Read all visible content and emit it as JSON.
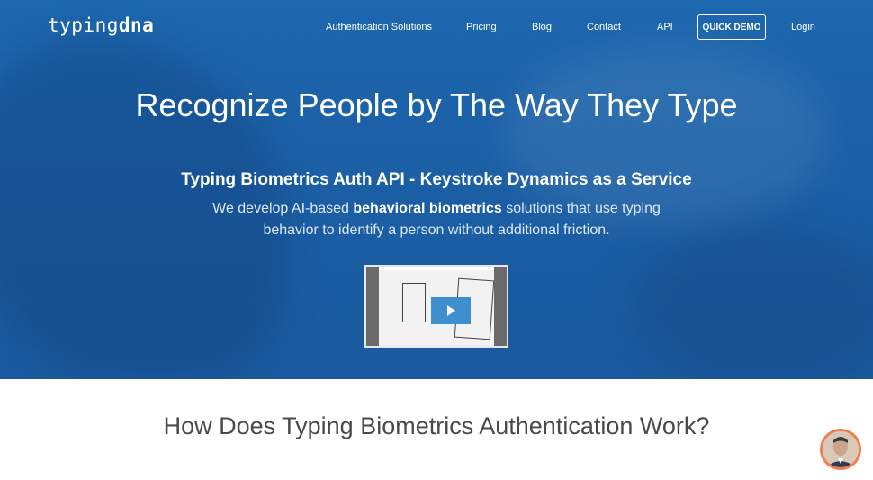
{
  "brand": {
    "logo_light": "typing",
    "logo_bold": "dna"
  },
  "nav": {
    "items": [
      "Authentication Solutions",
      "Pricing",
      "Blog",
      "Contact",
      "API"
    ],
    "demo_label": "QUICK DEMO",
    "login_label": "Login"
  },
  "hero": {
    "headline": "Recognize People by The Way They Type",
    "subheadline": "Typing Biometrics Auth API - Keystroke Dynamics as a Service",
    "desc_before": "We develop AI-based ",
    "desc_bold": "behavioral biometrics",
    "desc_after": " solutions that use typing behavior to identify a person without additional friction.",
    "video_icon": "play-icon"
  },
  "section": {
    "title": "How Does Typing Biometrics Authentication Work?"
  },
  "chat": {
    "icon": "chat-avatar"
  },
  "colors": {
    "hero_bg": "#1b5fa5",
    "play": "#3f8fd0",
    "avatar_ring": "#f07e4f"
  }
}
